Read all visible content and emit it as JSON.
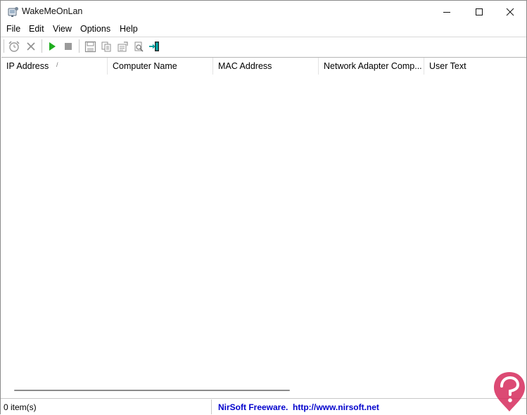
{
  "window": {
    "title": "WakeMeOnLan"
  },
  "menubar": {
    "items": [
      "File",
      "Edit",
      "View",
      "Options",
      "Help"
    ]
  },
  "toolbar": {
    "buttons": [
      {
        "icon": "alarm-clock-icon",
        "enabled": false
      },
      {
        "icon": "delete-x-icon",
        "enabled": false
      },
      {
        "icon": "play-icon",
        "enabled": true,
        "color": "#1fae1f"
      },
      {
        "icon": "stop-icon",
        "enabled": false
      },
      {
        "icon": "save-icon",
        "enabled": false
      },
      {
        "icon": "copy-icon",
        "enabled": false
      },
      {
        "icon": "properties-icon",
        "enabled": false
      },
      {
        "icon": "find-icon",
        "enabled": false
      },
      {
        "icon": "exit-icon",
        "enabled": true,
        "color": "#00a0a0"
      }
    ]
  },
  "listview": {
    "columns": [
      "IP Address",
      "Computer Name",
      "MAC Address",
      "Network Adapter Comp...",
      "User Text"
    ],
    "sort_indicator": "/",
    "rows": []
  },
  "statusbar": {
    "count": "0 item(s)",
    "link": "NirSoft Freeware.  http://www.nirsoft.net",
    "link_color": "#0000cc"
  },
  "colors": {
    "accent_play": "#1fae1f",
    "accent_exit": "#00a0a0",
    "watermark": "#d62a5c"
  }
}
